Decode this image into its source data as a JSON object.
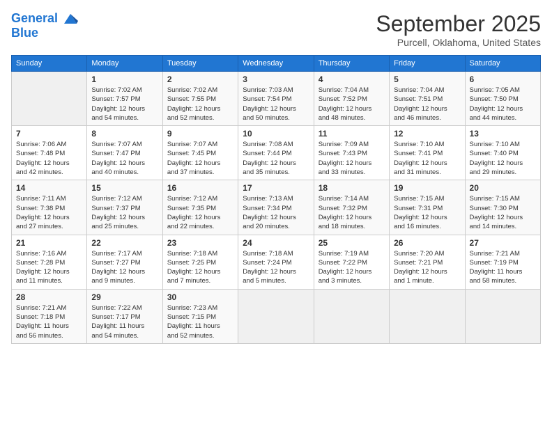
{
  "logo": {
    "line1": "General",
    "line2": "Blue"
  },
  "title": "September 2025",
  "subtitle": "Purcell, Oklahoma, United States",
  "days_header": [
    "Sunday",
    "Monday",
    "Tuesday",
    "Wednesday",
    "Thursday",
    "Friday",
    "Saturday"
  ],
  "weeks": [
    [
      {
        "day": "",
        "info": ""
      },
      {
        "day": "1",
        "info": "Sunrise: 7:02 AM\nSunset: 7:57 PM\nDaylight: 12 hours\nand 54 minutes."
      },
      {
        "day": "2",
        "info": "Sunrise: 7:02 AM\nSunset: 7:55 PM\nDaylight: 12 hours\nand 52 minutes."
      },
      {
        "day": "3",
        "info": "Sunrise: 7:03 AM\nSunset: 7:54 PM\nDaylight: 12 hours\nand 50 minutes."
      },
      {
        "day": "4",
        "info": "Sunrise: 7:04 AM\nSunset: 7:52 PM\nDaylight: 12 hours\nand 48 minutes."
      },
      {
        "day": "5",
        "info": "Sunrise: 7:04 AM\nSunset: 7:51 PM\nDaylight: 12 hours\nand 46 minutes."
      },
      {
        "day": "6",
        "info": "Sunrise: 7:05 AM\nSunset: 7:50 PM\nDaylight: 12 hours\nand 44 minutes."
      }
    ],
    [
      {
        "day": "7",
        "info": "Sunrise: 7:06 AM\nSunset: 7:48 PM\nDaylight: 12 hours\nand 42 minutes."
      },
      {
        "day": "8",
        "info": "Sunrise: 7:07 AM\nSunset: 7:47 PM\nDaylight: 12 hours\nand 40 minutes."
      },
      {
        "day": "9",
        "info": "Sunrise: 7:07 AM\nSunset: 7:45 PM\nDaylight: 12 hours\nand 37 minutes."
      },
      {
        "day": "10",
        "info": "Sunrise: 7:08 AM\nSunset: 7:44 PM\nDaylight: 12 hours\nand 35 minutes."
      },
      {
        "day": "11",
        "info": "Sunrise: 7:09 AM\nSunset: 7:43 PM\nDaylight: 12 hours\nand 33 minutes."
      },
      {
        "day": "12",
        "info": "Sunrise: 7:10 AM\nSunset: 7:41 PM\nDaylight: 12 hours\nand 31 minutes."
      },
      {
        "day": "13",
        "info": "Sunrise: 7:10 AM\nSunset: 7:40 PM\nDaylight: 12 hours\nand 29 minutes."
      }
    ],
    [
      {
        "day": "14",
        "info": "Sunrise: 7:11 AM\nSunset: 7:38 PM\nDaylight: 12 hours\nand 27 minutes."
      },
      {
        "day": "15",
        "info": "Sunrise: 7:12 AM\nSunset: 7:37 PM\nDaylight: 12 hours\nand 25 minutes."
      },
      {
        "day": "16",
        "info": "Sunrise: 7:12 AM\nSunset: 7:35 PM\nDaylight: 12 hours\nand 22 minutes."
      },
      {
        "day": "17",
        "info": "Sunrise: 7:13 AM\nSunset: 7:34 PM\nDaylight: 12 hours\nand 20 minutes."
      },
      {
        "day": "18",
        "info": "Sunrise: 7:14 AM\nSunset: 7:32 PM\nDaylight: 12 hours\nand 18 minutes."
      },
      {
        "day": "19",
        "info": "Sunrise: 7:15 AM\nSunset: 7:31 PM\nDaylight: 12 hours\nand 16 minutes."
      },
      {
        "day": "20",
        "info": "Sunrise: 7:15 AM\nSunset: 7:30 PM\nDaylight: 12 hours\nand 14 minutes."
      }
    ],
    [
      {
        "day": "21",
        "info": "Sunrise: 7:16 AM\nSunset: 7:28 PM\nDaylight: 12 hours\nand 11 minutes."
      },
      {
        "day": "22",
        "info": "Sunrise: 7:17 AM\nSunset: 7:27 PM\nDaylight: 12 hours\nand 9 minutes."
      },
      {
        "day": "23",
        "info": "Sunrise: 7:18 AM\nSunset: 7:25 PM\nDaylight: 12 hours\nand 7 minutes."
      },
      {
        "day": "24",
        "info": "Sunrise: 7:18 AM\nSunset: 7:24 PM\nDaylight: 12 hours\nand 5 minutes."
      },
      {
        "day": "25",
        "info": "Sunrise: 7:19 AM\nSunset: 7:22 PM\nDaylight: 12 hours\nand 3 minutes."
      },
      {
        "day": "26",
        "info": "Sunrise: 7:20 AM\nSunset: 7:21 PM\nDaylight: 12 hours\nand 1 minute."
      },
      {
        "day": "27",
        "info": "Sunrise: 7:21 AM\nSunset: 7:19 PM\nDaylight: 11 hours\nand 58 minutes."
      }
    ],
    [
      {
        "day": "28",
        "info": "Sunrise: 7:21 AM\nSunset: 7:18 PM\nDaylight: 11 hours\nand 56 minutes."
      },
      {
        "day": "29",
        "info": "Sunrise: 7:22 AM\nSunset: 7:17 PM\nDaylight: 11 hours\nand 54 minutes."
      },
      {
        "day": "30",
        "info": "Sunrise: 7:23 AM\nSunset: 7:15 PM\nDaylight: 11 hours\nand 52 minutes."
      },
      {
        "day": "",
        "info": ""
      },
      {
        "day": "",
        "info": ""
      },
      {
        "day": "",
        "info": ""
      },
      {
        "day": "",
        "info": ""
      }
    ]
  ]
}
